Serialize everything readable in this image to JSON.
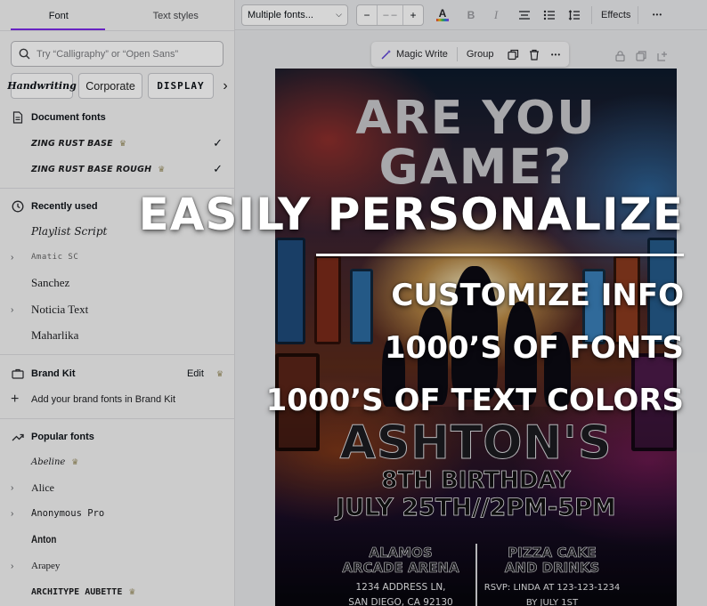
{
  "panel": {
    "tabs": [
      {
        "label": "Font"
      },
      {
        "label": "Text styles"
      }
    ],
    "search_placeholder": "Try “Calligraphy” or “Open Sans”",
    "chips": [
      {
        "label": "Handwriting"
      },
      {
        "label": "Corporate"
      },
      {
        "label": "DISPLAY"
      }
    ],
    "document_fonts": {
      "title": "Document fonts",
      "items": [
        {
          "label": "ZING RUST BASE",
          "checked": true
        },
        {
          "label": "ZING RUST BASE ROUGH",
          "checked": true
        }
      ]
    },
    "recently_used": {
      "title": "Recently used",
      "items": [
        {
          "label": "Playlist Script"
        },
        {
          "label": "Amatic SC"
        },
        {
          "label": "Sanchez"
        },
        {
          "label": "Noticia Text"
        },
        {
          "label": "Maharlika"
        }
      ]
    },
    "brand_kit": {
      "title": "Brand Kit",
      "edit_label": "Edit",
      "add_label": "Add your brand fonts in Brand Kit"
    },
    "popular_fonts": {
      "title": "Popular fonts",
      "items": [
        {
          "label": "Abeline"
        },
        {
          "label": "Alice"
        },
        {
          "label": "Anonymous Pro"
        },
        {
          "label": "Anton"
        },
        {
          "label": "Arapey"
        },
        {
          "label": "ARCHITYPE AUBETTE"
        }
      ]
    }
  },
  "toolbar": {
    "font_select": "Multiple fonts...",
    "size_minus": "−",
    "size_value": "– –",
    "size_plus": "+",
    "color_letter": "A",
    "bold": "B",
    "italic": "I",
    "effects_label": "Effects",
    "more": "•••"
  },
  "context_bar": {
    "magic_write": "Magic Write",
    "group": "Group",
    "more": "•••"
  },
  "poster": {
    "title_line1": "ARE YOU",
    "title_line2": "GAME?",
    "name": "ASHTON'S",
    "birthday": "8TH BIRTHDAY",
    "date": "JULY 25TH//2PM-5PM",
    "venue_line1": "ALAMOS",
    "venue_line2": "ARCADE ARENA",
    "address_line1": "1234 ADDRESS LN,",
    "address_line2": "SAN DIEGO, CA 92130",
    "food_line1": "PIZZA CAKE",
    "food_line2": "AND DRINKS",
    "rsvp_line1": "RSVP: LINDA AT 123-123-1234",
    "rsvp_line2": "BY JULY 1ST"
  },
  "overlay": {
    "headline": "EASILY PERSONALIZE",
    "line1": "CUSTOMIZE INFO",
    "line2": "1000’S OF FONTS",
    "line3": "1000’S OF TEXT COLORS"
  },
  "colors": {
    "accent": "#7c2ae8",
    "panel_bg": "#f3f3f4",
    "overlay_text": "#ffffff"
  }
}
